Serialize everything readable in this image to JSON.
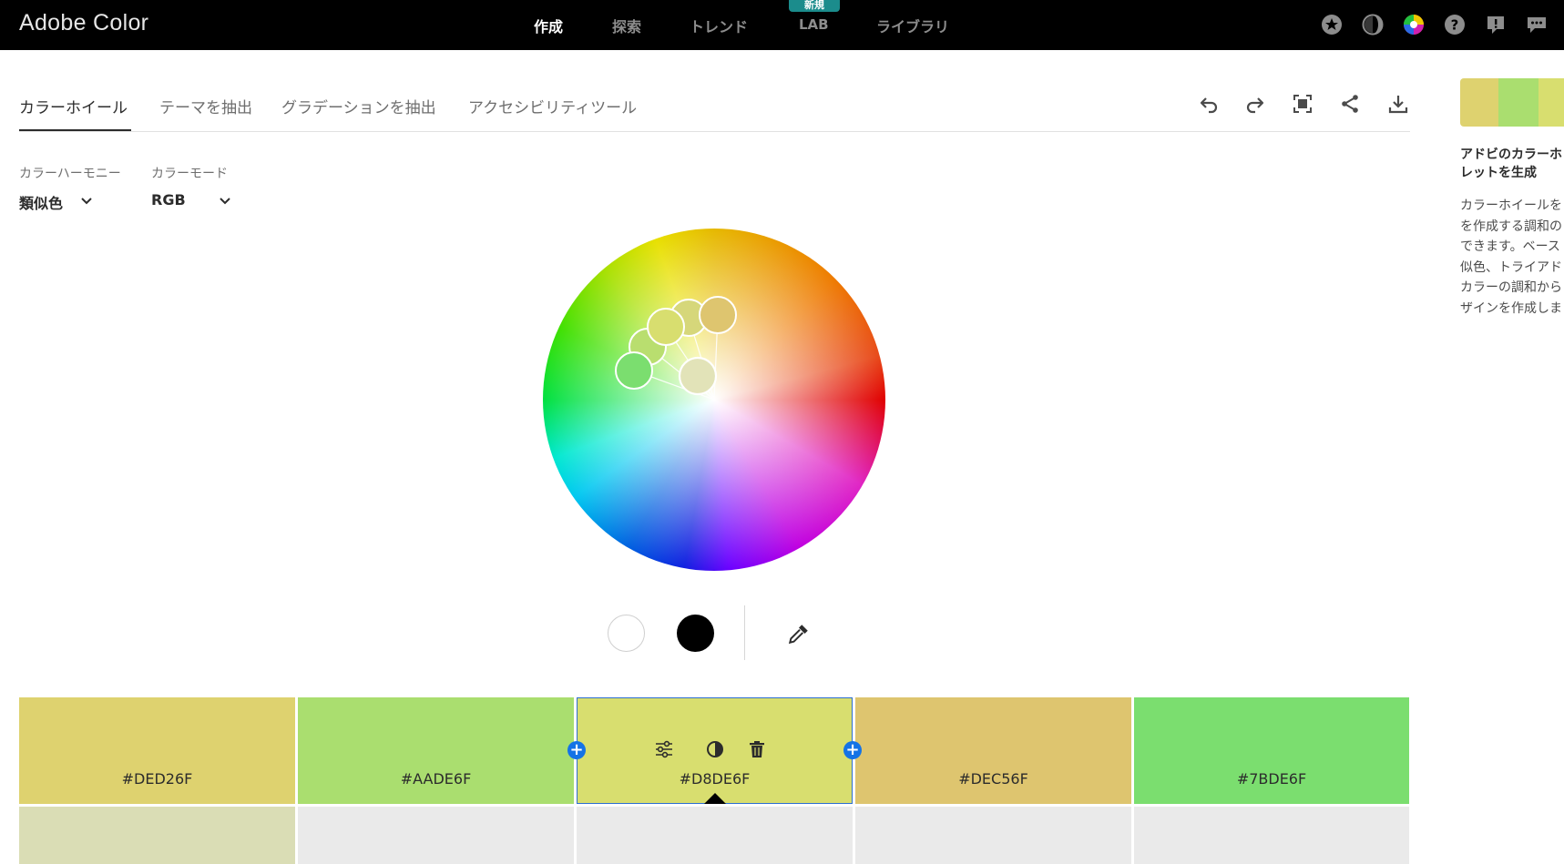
{
  "app": {
    "title": "Adobe Color"
  },
  "nav": {
    "items": [
      {
        "label": "作成",
        "active": true
      },
      {
        "label": "探索",
        "active": false
      },
      {
        "label": "トレンド",
        "active": false
      },
      {
        "label": "LAB",
        "active": false
      },
      {
        "label": "ライブラリ",
        "active": false
      }
    ],
    "lab_badge": "新規"
  },
  "top_icons": [
    "star-icon",
    "contrast-moon-icon",
    "color-wheel-icon",
    "help-icon",
    "feedback-alert-icon",
    "chat-icon"
  ],
  "tabs": [
    {
      "label": "カラーホイール",
      "active": true
    },
    {
      "label": "テーマを抽出",
      "active": false
    },
    {
      "label": "グラデーションを抽出",
      "active": false
    },
    {
      "label": "アクセシビリティツール",
      "active": false
    }
  ],
  "toolbar": [
    "undo-icon",
    "redo-icon",
    "fullscreen-icon",
    "share-icon",
    "download-icon"
  ],
  "harmony": {
    "label": "カラーハーモニー",
    "value": "類似色"
  },
  "mode": {
    "label": "カラーモード",
    "value": "RGB"
  },
  "wheel_controls": [
    "white-circle",
    "black-circle",
    "eyedropper-icon"
  ],
  "swatches": [
    {
      "hex": "#DED26F",
      "color": "#DED26F",
      "selected": false
    },
    {
      "hex": "#AADE6F",
      "color": "#AADE6F",
      "selected": false
    },
    {
      "hex": "#D8DE6F",
      "color": "#D8DE6F",
      "selected": true
    },
    {
      "hex": "#DEC56F",
      "color": "#DEC56F",
      "selected": false
    },
    {
      "hex": "#7BDE6F",
      "color": "#7BDE6F",
      "selected": false
    }
  ],
  "shade_colors": [
    "#DADDB5",
    "#EAEAEA",
    "#EAEAEA",
    "#EAEAEA",
    "#EAEAEA"
  ],
  "right_panel": {
    "title_line1": "アドビのカラーホ",
    "title_line2": "レットを生成",
    "body_lines": [
      "カラーホイールを",
      "を作成する調和の",
      "できます。ベース",
      "似色、トライアド",
      "カラーの調和から",
      "ザインを作成しま"
    ]
  }
}
